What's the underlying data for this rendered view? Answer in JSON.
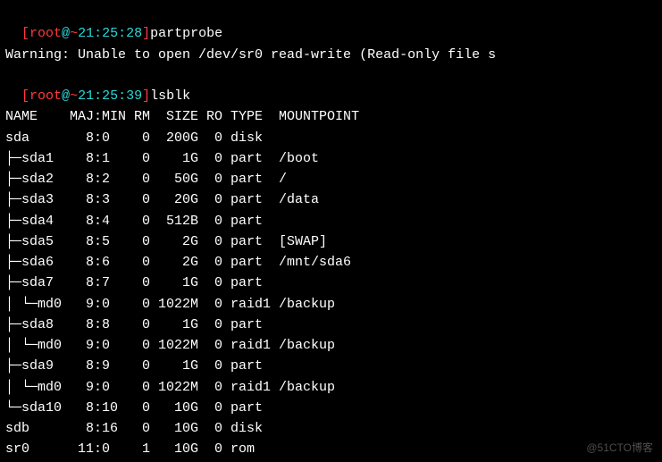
{
  "prompt1": {
    "open_bracket": "[",
    "user": "root",
    "at": "@",
    "tilde": "~",
    "time": "21:25:28",
    "close_bracket": "]",
    "command": "partprobe"
  },
  "warning_text": "Warning: Unable to open /dev/sr0 read-write (Read-only file s",
  "prompt2": {
    "open_bracket": "[",
    "user": "root",
    "at": "@",
    "tilde": "~",
    "time": "21:25:39",
    "close_bracket": "]",
    "command": "lsblk"
  },
  "header": "NAME    MAJ:MIN RM  SIZE RO TYPE  MOUNTPOINT",
  "rows": [
    "sda       8:0    0  200G  0 disk",
    "├─sda1    8:1    0    1G  0 part  /boot",
    "├─sda2    8:2    0   50G  0 part  /",
    "├─sda3    8:3    0   20G  0 part  /data",
    "├─sda4    8:4    0  512B  0 part",
    "├─sda5    8:5    0    2G  0 part  [SWAP]",
    "├─sda6    8:6    0    2G  0 part  /mnt/sda6",
    "├─sda7    8:7    0    1G  0 part",
    "│ └─md0   9:0    0 1022M  0 raid1 /backup",
    "├─sda8    8:8    0    1G  0 part",
    "│ └─md0   9:0    0 1022M  0 raid1 /backup",
    "├─sda9    8:9    0    1G  0 part",
    "│ └─md0   9:0    0 1022M  0 raid1 /backup",
    "└─sda10   8:10   0   10G  0 part",
    "sdb       8:16   0   10G  0 disk",
    "sr0      11:0    1   10G  0 rom"
  ],
  "watermark": "@51CTO博客"
}
